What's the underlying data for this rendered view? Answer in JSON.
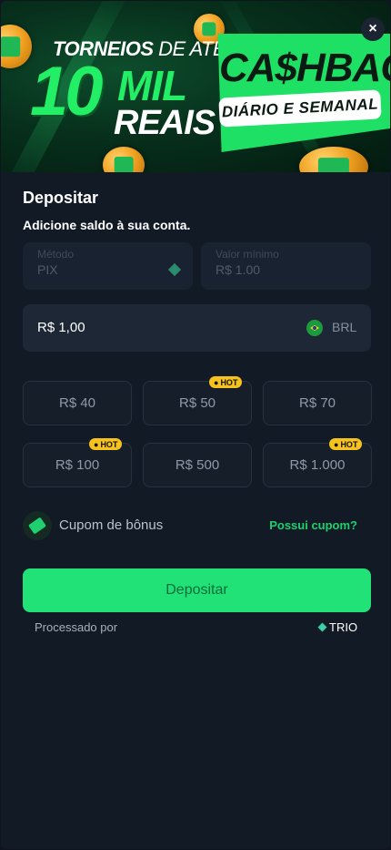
{
  "banner": {
    "torneios": "TORNEIOS",
    "de_ate": "DE ATÉ",
    "ten": "10",
    "mil": "MIL",
    "reais": "REAIS",
    "cashback": "CA$HBACK",
    "frequency": "DIÁRIO E SEMANAL"
  },
  "close_label": "×",
  "page": {
    "title": "Depositar",
    "subtitle": "Adicione saldo à sua conta."
  },
  "method": {
    "label": "Método",
    "value": "PIX",
    "icon": "pix-icon"
  },
  "min_value": {
    "label": "Valor mínimo",
    "value": "R$ 1.00"
  },
  "amount": {
    "value": "R$ 1,00",
    "currency": "BRL",
    "flag_icon": "brazil-flag-icon"
  },
  "presets": [
    {
      "label": "R$ 40",
      "hot": false
    },
    {
      "label": "R$ 50",
      "hot": true
    },
    {
      "label": "R$ 70",
      "hot": false
    },
    {
      "label": "R$ 100",
      "hot": true
    },
    {
      "label": "R$ 500",
      "hot": false
    },
    {
      "label": "R$ 1.000",
      "hot": true
    }
  ],
  "hot_label": "HOT",
  "coupon": {
    "label": "Cupom de bônus",
    "link": "Possui cupom?",
    "icon": "ticket-icon"
  },
  "submit": {
    "label": "Depositar"
  },
  "footer": {
    "processed_by": "Processado por",
    "provider": "TRIO"
  },
  "colors": {
    "accent": "#20e277",
    "background": "#121a25",
    "hot": "#f6c21e"
  }
}
